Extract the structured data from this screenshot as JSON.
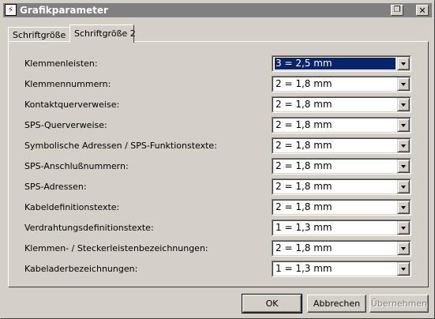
{
  "window": {
    "title": "Grafikparameter",
    "app_icon": "app-logo-icon",
    "buttons": {
      "copy_icon": "restore-icon",
      "close_glyph": "✕"
    }
  },
  "tabs": [
    {
      "label": "Schriftgröße 1",
      "active": false
    },
    {
      "label": "Schriftgröße 2",
      "active": true
    }
  ],
  "rows": [
    {
      "label": "Klemmenleisten:",
      "value": "3 = 2,5 mm",
      "selected": true
    },
    {
      "label": "Klemmennummern:",
      "value": "2 = 1,8 mm"
    },
    {
      "label": "Kontaktquerverweise:",
      "value": "2 = 1,8 mm"
    },
    {
      "label": "SPS-Querverweise:",
      "value": "2 = 1,8 mm"
    },
    {
      "label": "Symbolische Adressen / SPS-Funktionstexte:",
      "value": "2 = 1,8 mm"
    },
    {
      "label": "SPS-Anschlußnummern:",
      "value": "2 = 1,8 mm"
    },
    {
      "label": "SPS-Adressen:",
      "value": "2 = 1,8 mm"
    },
    {
      "label": "Kabeldefinitionstexte:",
      "value": "2 = 1,8 mm"
    },
    {
      "label": "Verdrahtungsdefinitionstexte:",
      "value": "1 = 1,3 mm"
    },
    {
      "label": "Klemmen- / Steckerleistenbezeichnungen:",
      "value": "2 = 1,8 mm"
    },
    {
      "label": "Kabeladerbezeichnungen:",
      "value": "1 = 1,3 mm"
    }
  ],
  "footer": {
    "ok_label": "OK",
    "cancel_label": "Abbrechen",
    "apply_label": "Übernehmen"
  },
  "colors": {
    "face": "#d4d0c8",
    "title_inactive": "#808080",
    "selection": "#0a246a"
  }
}
